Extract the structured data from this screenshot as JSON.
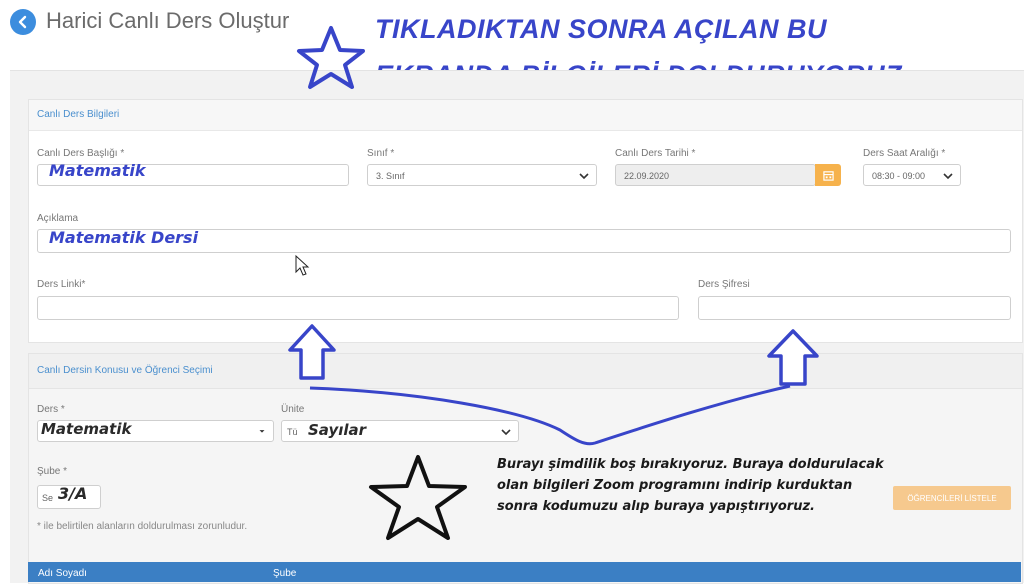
{
  "header": {
    "title": "Harici Canlı Ders Oluştur"
  },
  "banner": {
    "line1": "TIKLADIKTAN SONRA AÇILAN BU",
    "line2": "EKRANDA BİLGİLERİ DOLDURUYORUZ"
  },
  "section1": {
    "title": "Canlı Ders Bilgileri",
    "baslik_label": "Canlı Ders Başlığı *",
    "baslik_value": "Matematik",
    "sinif_label": "Sınıf *",
    "sinif_value": "3. Sınıf",
    "tarih_label": "Canlı Ders Tarihi *",
    "tarih_value": "22.09.2020",
    "saat_label": "Ders Saat Aralığı *",
    "saat_value": "08:30 - 09:00",
    "aciklama_label": "Açıklama",
    "aciklama_value": "Matematik Dersi",
    "link_label": "Ders Linki*",
    "sifre_label": "Ders Şifresi"
  },
  "section2": {
    "title": "Canlı Dersin Konusu ve Öğrenci Seçimi",
    "ders_label": "Ders *",
    "ders_value": "Matematik",
    "unite_label": "Ünite",
    "unite_prefix": "Tü",
    "unite_value": "Sayılar",
    "sube_label": "Şube *",
    "sube_prefix": "Se",
    "sube_value": "3/A",
    "required_note": "* ile belirtilen alanların doldurulması zorunludur.",
    "list_button": "ÖĞRENCİLERİ LİSTELE"
  },
  "annotation": {
    "note": "Burayı şimdilik boş bırakıyoruz. Buraya doldurulacak olan bilgileri Zoom programını indirip kurduktan sonra kodumuzu alıp buraya yapıştırıyoruz."
  },
  "table": {
    "col_name": "Adı Soyadı",
    "col_sube": "Şube"
  },
  "colors": {
    "accent_blue": "#3c8dde",
    "annotation_blue": "#3845c9",
    "orange": "#f6b24c"
  }
}
